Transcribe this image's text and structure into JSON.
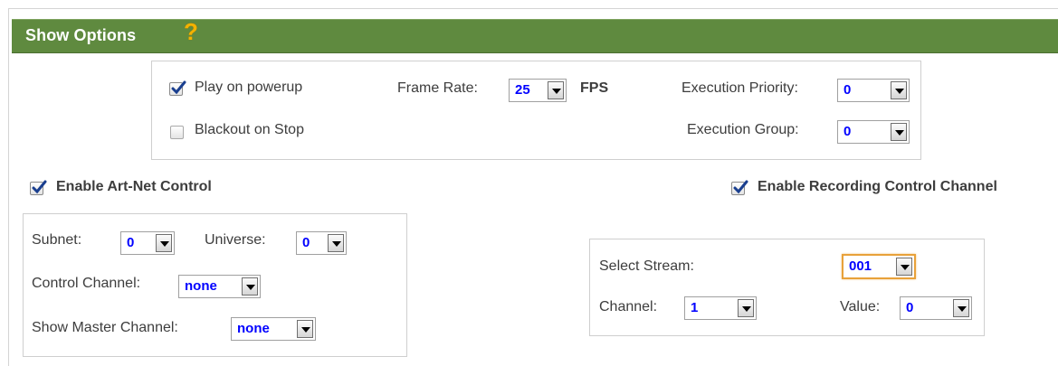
{
  "header": {
    "title": "Show Options",
    "help_icon": "question-mark-icon",
    "color": "#5f8a3f"
  },
  "playback": {
    "play_on_powerup": {
      "label": "Play on powerup",
      "checked": true
    },
    "blackout_on_stop": {
      "label": "Blackout on Stop",
      "checked": false
    },
    "frame_rate": {
      "label": "Frame Rate:",
      "value": "25",
      "unit": "FPS"
    },
    "execution_priority": {
      "label": "Execution Priority:",
      "value": "0"
    },
    "execution_group": {
      "label": "Execution Group:",
      "value": "0"
    }
  },
  "artnet": {
    "enable": {
      "label": "Enable Art-Net Control",
      "checked": true
    },
    "subnet": {
      "label": "Subnet:",
      "value": "0"
    },
    "universe": {
      "label": "Universe:",
      "value": "0"
    },
    "control_channel": {
      "label": "Control Channel:",
      "value": "none"
    },
    "show_master_channel": {
      "label": "Show Master Channel:",
      "value": "none"
    }
  },
  "recording": {
    "enable": {
      "label": "Enable Recording Control Channel",
      "checked": true
    },
    "select_stream": {
      "label": "Select Stream:",
      "value": "001"
    },
    "channel": {
      "label": "Channel:",
      "value": "1"
    },
    "value": {
      "label": "Value:",
      "value": "0"
    }
  },
  "colors": {
    "select_value": "#0000ff",
    "focus_border": "#e8a13a",
    "help_icon": "#f3b200"
  }
}
